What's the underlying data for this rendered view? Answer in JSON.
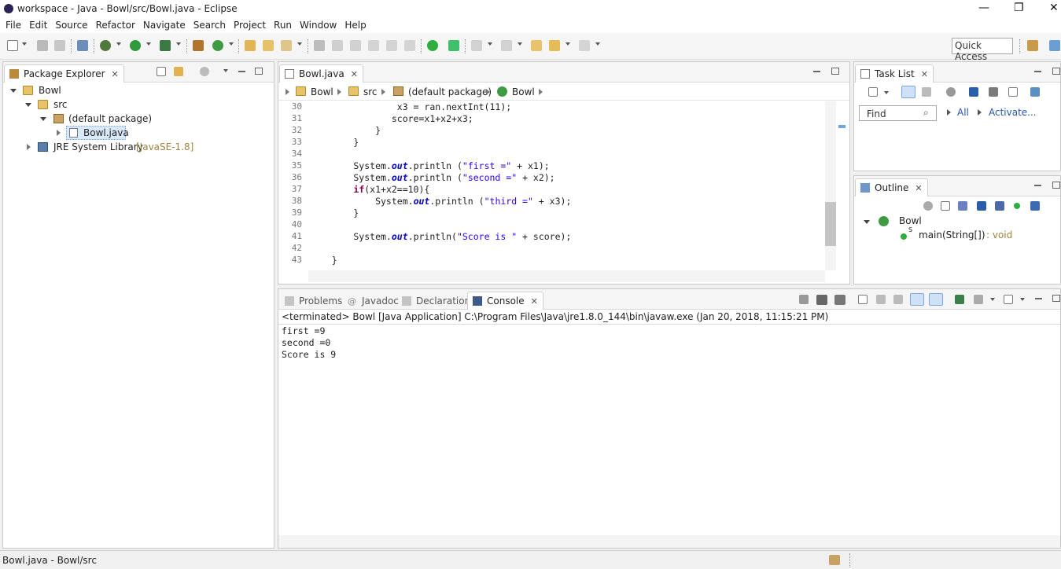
{
  "window": {
    "title": "workspace - Java - Bowl/src/Bowl.java - Eclipse",
    "controls": [
      "—",
      "❐",
      "✕"
    ]
  },
  "menu": [
    "File",
    "Edit",
    "Source",
    "Refactor",
    "Navigate",
    "Search",
    "Project",
    "Run",
    "Window",
    "Help"
  ],
  "toolbar": {
    "quick_access": "Quick Access"
  },
  "package_explorer": {
    "tab_label": "Package Explorer",
    "tree": [
      {
        "label": "Bowl",
        "depth": 0,
        "expanded": true,
        "icon": "project-icon"
      },
      {
        "label": "src",
        "depth": 1,
        "expanded": true,
        "icon": "source-folder-icon"
      },
      {
        "label": "(default package)",
        "depth": 2,
        "expanded": true,
        "icon": "package-icon"
      },
      {
        "label": "Bowl.java",
        "depth": 3,
        "expanded": false,
        "icon": "java-file-icon",
        "selected": true
      },
      {
        "label": "JRE System Library",
        "suffix": "[JavaSE-1.8]",
        "depth": 1,
        "expanded": false,
        "icon": "library-icon"
      }
    ]
  },
  "editor": {
    "tab_label": "Bowl.java",
    "breadcrumb": [
      "Bowl",
      "src",
      "(default package)",
      "Bowl"
    ],
    "lines": [
      {
        "no": "30",
        "text": "                x3 = ran.nextInt(11);"
      },
      {
        "no": "31",
        "text": "               score=x1+x2+x3;"
      },
      {
        "no": "32",
        "text": "            }"
      },
      {
        "no": "33",
        "text": "        }"
      },
      {
        "no": "34",
        "text": ""
      },
      {
        "no": "35",
        "text": "        System.out.println (\"first =\" + x1);"
      },
      {
        "no": "36",
        "text": "        System.out.println (\"second =\" + x2);"
      },
      {
        "no": "37",
        "text": "        if(x1+x2==10){"
      },
      {
        "no": "38",
        "text": "            System.out.println (\"third =\" + x3);"
      },
      {
        "no": "39",
        "text": "        }"
      },
      {
        "no": "40",
        "text": ""
      },
      {
        "no": "41",
        "text": "        System.out.println(\"Score is \" + score);"
      },
      {
        "no": "42",
        "text": ""
      },
      {
        "no": "43",
        "text": "    }"
      }
    ]
  },
  "task_list": {
    "tab_label": "Task List",
    "find_placeholder": "Find",
    "all_label": "All",
    "activate_label": "Activate..."
  },
  "outline": {
    "tab_label": "Outline",
    "class_name": "Bowl",
    "method": "main(String[])",
    "method_type": " : void"
  },
  "bottom_panel": {
    "tabs": [
      "Problems",
      "Javadoc",
      "Declaration",
      "Console"
    ],
    "active_tab": "Console",
    "terminated_line": "<terminated> Bowl [Java Application] C:\\Program Files\\Java\\jre1.8.0_144\\bin\\javaw.exe (Jan 20, 2018, 11:15:21 PM)",
    "output": [
      "first =9",
      "second =0",
      "Score is 9"
    ]
  },
  "status_bar": {
    "text": "Bowl.java - Bowl/src"
  },
  "colors": {
    "keyword": "#7f0055",
    "string": "#2a00ff",
    "field": "#0000c0"
  }
}
